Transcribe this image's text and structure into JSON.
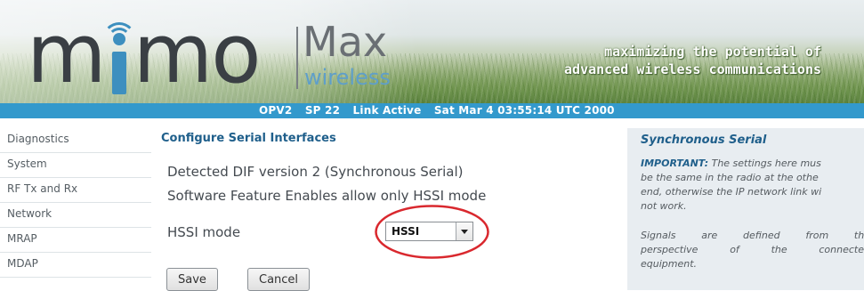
{
  "banner": {
    "logo_text_m1": "m",
    "logo_text_mo": "mo",
    "logo_max": "Max",
    "logo_wireless": "wireless",
    "tagline_1": "maximizing the potential of",
    "tagline_2": "advanced wireless communications",
    "status": {
      "device": "OPV2",
      "sp": "SP 22",
      "link": "Link Active",
      "datetime": "Sat Mar 4 03:55:14 UTC 2000"
    }
  },
  "sidebar": {
    "items": [
      {
        "label": "Diagnostics"
      },
      {
        "label": "System"
      },
      {
        "label": "RF Tx and Rx"
      },
      {
        "label": "Network"
      },
      {
        "label": "MRAP"
      },
      {
        "label": "MDAP"
      }
    ]
  },
  "main": {
    "title": "Configure Serial Interfaces",
    "detected": "Detected DIF version 2 (Synchronous Serial)",
    "feature": "Software Feature Enables allow only HSSI mode",
    "hssi_label": "HSSI mode",
    "hssi_value": "HSSI",
    "save_label": "Save",
    "cancel_label": "Cancel"
  },
  "help": {
    "title": "Synchronous Serial",
    "important_label": "IMPORTANT:",
    "important_1": " The settings here mus",
    "important_2": "be the same in the radio at the othe",
    "important_3": "end, otherwise the IP network link wi",
    "important_4": "not work.",
    "signals_1_words": [
      "Signals",
      "are",
      "defined",
      "from",
      "the"
    ],
    "signals_2_words": [
      "perspective",
      "of",
      "the",
      "connected"
    ],
    "signals_3": "equipment."
  },
  "colors": {
    "accent_blue": "#3399cc",
    "title_blue": "#1f5f8b",
    "annotation_red": "#d9282e"
  }
}
